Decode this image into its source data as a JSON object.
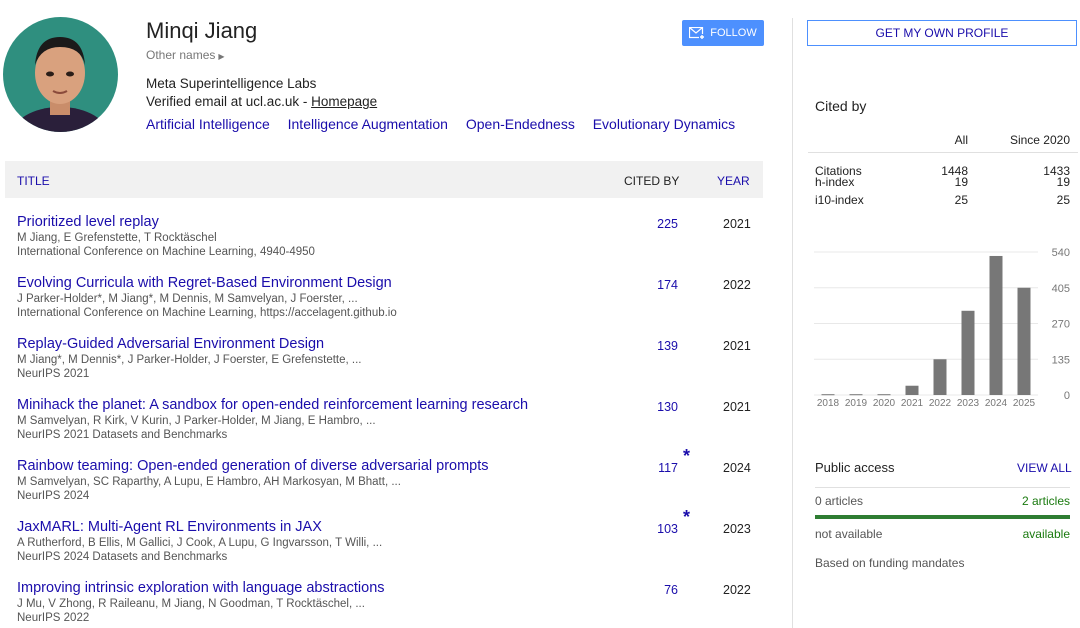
{
  "profile": {
    "name": "Minqi Jiang",
    "other_names": "Other names",
    "affiliation": "Meta Superintelligence Labs",
    "email_prefix": "Verified email at ucl.ac.uk - ",
    "homepage": "Homepage",
    "interests": [
      "Artificial Intelligence",
      "Intelligence Augmentation",
      "Open-Endedness",
      "Evolutionary Dynamics"
    ],
    "follow_label": "FOLLOW"
  },
  "table": {
    "headers": {
      "title": "TITLE",
      "cited_by": "CITED BY",
      "year": "YEAR"
    },
    "rows": [
      {
        "title": "Prioritized level replay",
        "authors": "M Jiang, E Grefenstette, T Rocktäschel",
        "venue": "International Conference on Machine Learning, 4940-4950",
        "cited": "225",
        "star": "",
        "year": "2021"
      },
      {
        "title": "Evolving Curricula with Regret-Based Environment Design",
        "authors": "J Parker-Holder*, M Jiang*, M Dennis, M Samvelyan, J Foerster, ...",
        "venue": "International Conference on Machine Learning, https://accelagent.github.io",
        "cited": "174",
        "star": "",
        "year": "2022"
      },
      {
        "title": "Replay-Guided Adversarial Environment Design",
        "authors": "M Jiang*, M Dennis*, J Parker-Holder, J Foerster, E Grefenstette, ...",
        "venue": "NeurIPS 2021",
        "cited": "139",
        "star": "",
        "year": "2021"
      },
      {
        "title": "Minihack the planet: A sandbox for open-ended reinforcement learning research",
        "authors": "M Samvelyan, R Kirk, V Kurin, J Parker-Holder, M Jiang, E Hambro, ...",
        "venue": "NeurIPS 2021 Datasets and Benchmarks",
        "cited": "130",
        "star": "",
        "year": "2021"
      },
      {
        "title": "Rainbow teaming: Open-ended generation of diverse adversarial prompts",
        "authors": "M Samvelyan, SC Raparthy, A Lupu, E Hambro, AH Markosyan, M Bhatt, ...",
        "venue": "NeurIPS 2024",
        "cited": "117",
        "star": "*",
        "year": "2024"
      },
      {
        "title": "JaxMARL: Multi-Agent RL Environments in JAX",
        "authors": "A Rutherford, B Ellis, M Gallici, J Cook, A Lupu, G Ingvarsson, T Willi, ...",
        "venue": "NeurIPS 2024 Datasets and Benchmarks",
        "cited": "103",
        "star": "*",
        "year": "2023"
      },
      {
        "title": "Improving intrinsic exploration with language abstractions",
        "authors": "J Mu, V Zhong, R Raileanu, M Jiang, N Goodman, T Rocktäschel, ...",
        "venue": "NeurIPS 2022",
        "cited": "76",
        "star": "",
        "year": "2022"
      }
    ]
  },
  "sidebar": {
    "get_profile": "GET MY OWN PROFILE",
    "cited_by_title": "Cited by",
    "stats_headers": [
      "",
      "All",
      "Since 2020"
    ],
    "stats": [
      {
        "label": "Citations",
        "all": "1448",
        "since": "1433"
      },
      {
        "label": "h-index",
        "all": "19",
        "since": "19"
      },
      {
        "label": "i10-index",
        "all": "25",
        "since": "25"
      }
    ],
    "public_access": {
      "title": "Public access",
      "view_all": "VIEW ALL",
      "left_count": "0 articles",
      "right_count": "2 articles",
      "left_status": "not available",
      "right_status": "available",
      "note": "Based on funding mandates"
    }
  },
  "chart_data": {
    "type": "bar",
    "categories": [
      "2018",
      "2019",
      "2020",
      "2021",
      "2022",
      "2023",
      "2024",
      "2025"
    ],
    "values": [
      3,
      3,
      3,
      35,
      135,
      318,
      525,
      405
    ],
    "y_ticks": [
      "0",
      "135",
      "270",
      "405",
      "540"
    ],
    "ylim": [
      0,
      540
    ],
    "bar_color": "#777777",
    "grid": true
  },
  "colors": {
    "link": "#1a0dab",
    "follow_bg": "#4d90fe",
    "access_green": "#2e7d32"
  }
}
